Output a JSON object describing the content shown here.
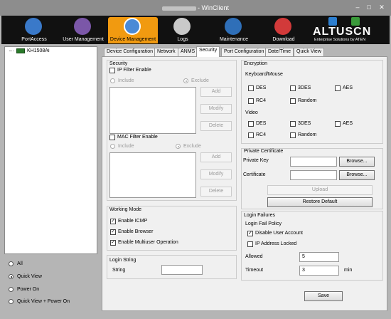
{
  "window": {
    "title": "- WinClient"
  },
  "toolbar": {
    "items": [
      {
        "label": "PortAccess",
        "icon": "port-access-icon",
        "color": "#3a79c9"
      },
      {
        "label": "User Management",
        "icon": "user-management-icon",
        "color": "#7b57a8"
      },
      {
        "label": "Device Management",
        "icon": "device-management-icon",
        "color": "#4a8ad6"
      },
      {
        "label": "Logs",
        "icon": "logs-icon",
        "color": "#c9c9c9"
      },
      {
        "label": "Maintenance",
        "icon": "maintenance-icon",
        "color": "#2f6fb8"
      },
      {
        "label": "Download",
        "icon": "download-icon",
        "color": "#d23a3a"
      }
    ],
    "brand": "ALTUSCN",
    "brand_sub": "Enterprise Solutions by ATEN"
  },
  "tree": {
    "node": "KH1508Ai"
  },
  "view_options": [
    "All",
    "Quick View",
    "Power On",
    "Quick View + Power On"
  ],
  "tabs": [
    "Device Configuration",
    "Network",
    "ANMS",
    "Security",
    "Port Configuration",
    "Date/Time",
    "Quick View"
  ],
  "security": {
    "title": "Security",
    "ip_filter": "IP Filter Enable",
    "include": "Include",
    "exclude": "Exclude",
    "add": "Add",
    "modify": "Modify",
    "delete": "Delete",
    "mac_filter": "MAC Filter Enable"
  },
  "encryption": {
    "title": "Encryption",
    "keyboard_mouse": "Keyboard/Mouse",
    "video": "Video",
    "des": "DES",
    "des3": "3DES",
    "aes": "AES",
    "rc4": "RC4",
    "random": "Random"
  },
  "private_cert": {
    "title": "Private Certificate",
    "private_key": "Private Key",
    "certificate": "Certificate",
    "browse": "Browse...",
    "upload": "Upload",
    "restore": "Restore Default"
  },
  "working_mode": {
    "title": "Working Mode",
    "icmp": "Enable ICMP",
    "browser": "Enable Browser",
    "multiuser": "Enable Multiuser Operation"
  },
  "login_string": {
    "title": "Login String",
    "label": "String",
    "value": ""
  },
  "login_failures": {
    "title": "Login Failures",
    "policy": "Login Fail Policy",
    "disable_user": "Disable User Account",
    "ip_locked": "IP Address Locked",
    "allowed_label": "Allowed",
    "allowed_value": "5",
    "timeout_label": "Timeout",
    "timeout_value": "3",
    "timeout_unit": "min"
  },
  "save": "Save"
}
